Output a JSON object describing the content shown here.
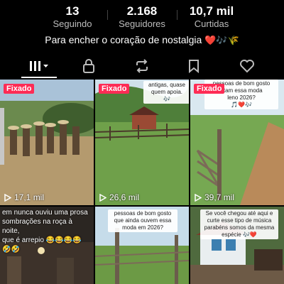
{
  "stats": [
    {
      "value": "13",
      "label": "Seguindo"
    },
    {
      "value": "2.168",
      "label": "Seguidores"
    },
    {
      "value": "10,7 mil",
      "label": "Curtidas"
    }
  ],
  "bio": {
    "text": "Para encher o coração de nostalgia",
    "emoji": "❤️🎶🌾"
  },
  "tabs": [
    {
      "name": "videos-grid-icon",
      "active": true
    },
    {
      "name": "lock-icon"
    },
    {
      "name": "repost-icon"
    },
    {
      "name": "bookmark-icon"
    },
    {
      "name": "heart-icon"
    }
  ],
  "videos": [
    {
      "pinned": "Fixado",
      "views": "17,1 mil",
      "overlay": ""
    },
    {
      "pinned": "Fixado",
      "views": "26,6 mil",
      "overlay": "antigas, quase\nquem apoia.\n🎶"
    },
    {
      "pinned": "Fixado",
      "views": "39,7 mil",
      "overlay": "pessoas de bom gosto\nutam essa moda\nleno 2026?\n🎵❤️🎶"
    },
    {
      "caption": "em nunca ouviu uma prosa\nsombrações na roça à noite,\n que é arrepio 😂😂😂😂\n🤣🤣"
    },
    {
      "overlay": "pessoas de bom gosto\nque ainda ouvem essa\nmoda em 2026?"
    },
    {
      "overlay": "Se você chegou até aqui e\ncurte esse tipo de música\nparabéns somos da mesma\nespécie 🎶❤️"
    }
  ],
  "colors": {
    "pinned": "#fe2c55",
    "background": "#000000"
  }
}
